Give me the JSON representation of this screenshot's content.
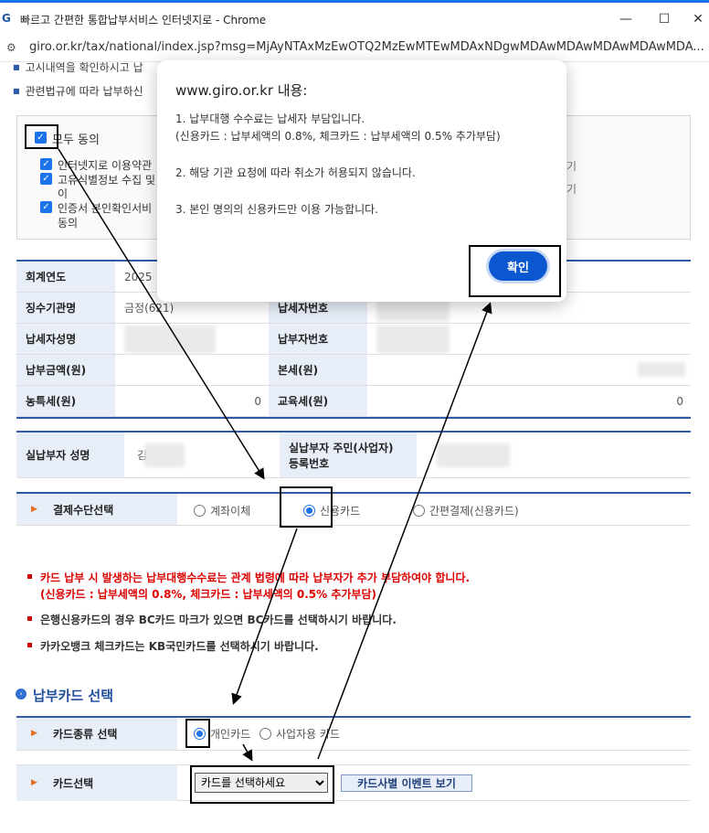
{
  "window": {
    "title": "빠르고 간편한 통합납부서비스 인터넷지로 - Chrome",
    "logo": "G",
    "url": "giro.or.kr/tax/national/index.jsp?msg=MjAyNTAxMzEwOTQ2MzEwMTEwMDAxNDgwMDAwMDAwMDAwMDAwMDA..."
  },
  "top_notices": [
    "고시내역을 확인하시고 납",
    "관련법규에 따라 납부하신"
  ],
  "agree": {
    "all_label": "모두 동의",
    "items": [
      "인터넷지로 이용약관",
      "고유식별정보 수집 및",
      "이",
      "인증서 본인확인서비",
      "동의"
    ],
    "side_marks": [
      "기",
      "기"
    ]
  },
  "info": {
    "year_label": "회계연도",
    "year_value": "2025",
    "agency_label": "징수기관명",
    "agency_value": "금정(621)",
    "taxpayer_no_label": "납세자번호",
    "payer_name_label": "납세자성명",
    "payer_no_label": "납부자번호",
    "amount_label": "납부금액(원)",
    "principal_label": "본세(원)",
    "farm_tax_label": "농특세(원)",
    "farm_tax_value": "0",
    "edu_tax_label": "교육세(원)",
    "edu_tax_value": "0"
  },
  "actual_payer": {
    "name_label": "실납부자 성명",
    "name_value": "김",
    "id_label_1": "실납부자 주민(사업자)",
    "id_label_2": "등록번호"
  },
  "payment_method": {
    "label": "결제수단선택",
    "options": [
      "계좌이체",
      "신용카드",
      "간편결제(신용카드)"
    ],
    "selected": 1
  },
  "notices": {
    "red_1": "카드 납부 시 발생하는 납부대행수수료는 관계 법령에 따라 납부자가 추가 부담하여야 합니다.",
    "red_2": "(신용카드 : 납부세액의 0.8%, 체크카드 : 납부세액의 0.5% 추가부담)",
    "n2": "은행신용카드의 경우 BC카드 마크가 있으면 BC카드를 선택하시기 바랍니다.",
    "n3": "카카오뱅크 체크카드는 KB국민카드를 선택하시기 바랍니다."
  },
  "card_section": {
    "title": "납부카드 선택",
    "type_label": "카드종류 선택",
    "type_options": [
      "개인카드",
      "사업자용 카드"
    ],
    "card_label": "카드선택",
    "select_value": "카드를 선택하세요",
    "event_button": "카드사별 이벤트 보기"
  },
  "dialog": {
    "title": "www.giro.or.kr 내용:",
    "line1": "1. 납부대행 수수료는 납세자 부담입니다.",
    "line2": "(신용카드 : 납부세액의 0.8%, 체크카드 : 납부세액의 0.5% 추가부담)",
    "line3": "2. 해당 기관 요청에 따라 취소가 허용되지 않습니다.",
    "line4": "3. 본인 명의의 신용카드만 이용 가능합니다.",
    "ok": "확인"
  },
  "colors": {
    "accent": "#1a73e8",
    "dialog_button": "#0b57d0",
    "header_cell": "#e8eef8",
    "warning": "#dd0000"
  }
}
